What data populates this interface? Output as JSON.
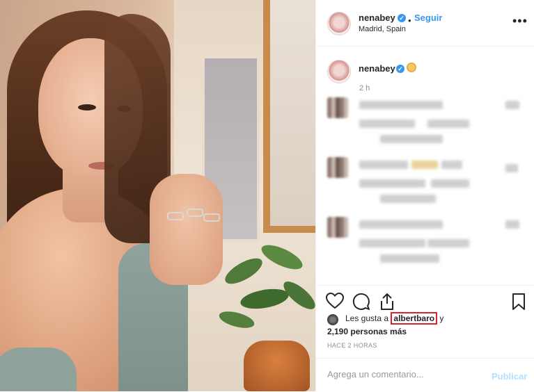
{
  "post": {
    "username": "nenabey",
    "follow_label": "Seguir",
    "location": "Madrid, Spain",
    "more_label": "•••"
  },
  "caption": {
    "username": "nenabey",
    "time": "2 h",
    "emoji": "bear-emoji"
  },
  "actions": {
    "icons": [
      "heart-icon",
      "comment-icon",
      "share-icon",
      "bookmark-icon"
    ]
  },
  "likes": {
    "prefix": "Les gusta a",
    "liker": "albertbaro",
    "suffix": "y",
    "others": "2,190 personas más"
  },
  "timestamp": "HACE 2 HORAS",
  "comment_box": {
    "placeholder": "Agrega un comentario...",
    "publish_label": "Publicar"
  },
  "colors": {
    "link_blue": "#3897f0",
    "publish_disabled": "#b2dffc",
    "highlight_red": "#d9232f",
    "meta_gray": "#8e8e8e"
  }
}
